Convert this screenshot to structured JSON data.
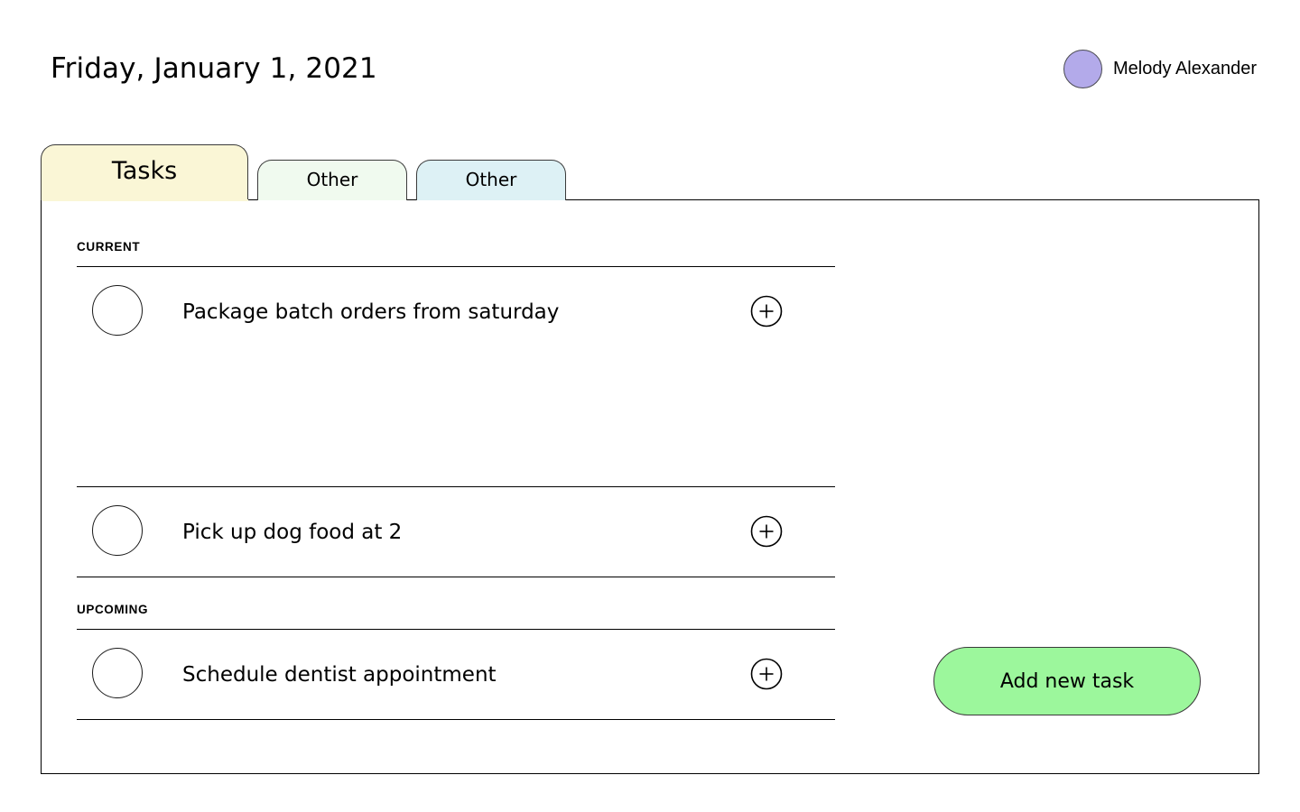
{
  "header": {
    "date_title": "Friday, January 1, 2021",
    "user": {
      "name": "Melody Alexander",
      "avatar_icon": "avatar-circle-icon",
      "avatar_color": "#b3aaea"
    }
  },
  "tabs": [
    {
      "label": "Tasks",
      "active": true,
      "color": "#faf6d6"
    },
    {
      "label": "Other",
      "active": false,
      "color": "#f0faef"
    },
    {
      "label": "Other",
      "active": false,
      "color": "#ddf1f5"
    }
  ],
  "sections": [
    {
      "id": "current",
      "heading": "CURRENT"
    },
    {
      "id": "upcoming",
      "heading": "UPCOMING"
    }
  ],
  "tasks": [
    {
      "title": "Package batch orders from saturday",
      "section": "CURRENT",
      "checkbox_icon": "circle-checkbox-icon",
      "checked": false,
      "action_icon": "plus-circle-icon"
    },
    {
      "title": "Pick up dog food at 2",
      "section": "CURRENT",
      "checkbox_icon": "circle-checkbox-icon",
      "checked": false,
      "action_icon": "plus-circle-icon"
    },
    {
      "title": "Schedule dentist appointment",
      "section": "UPCOMING",
      "checkbox_icon": "circle-checkbox-icon",
      "checked": false,
      "action_icon": "plus-circle-icon"
    }
  ],
  "actions": {
    "add_task_label": "Add new task",
    "add_task_color": "#9cf79c"
  }
}
